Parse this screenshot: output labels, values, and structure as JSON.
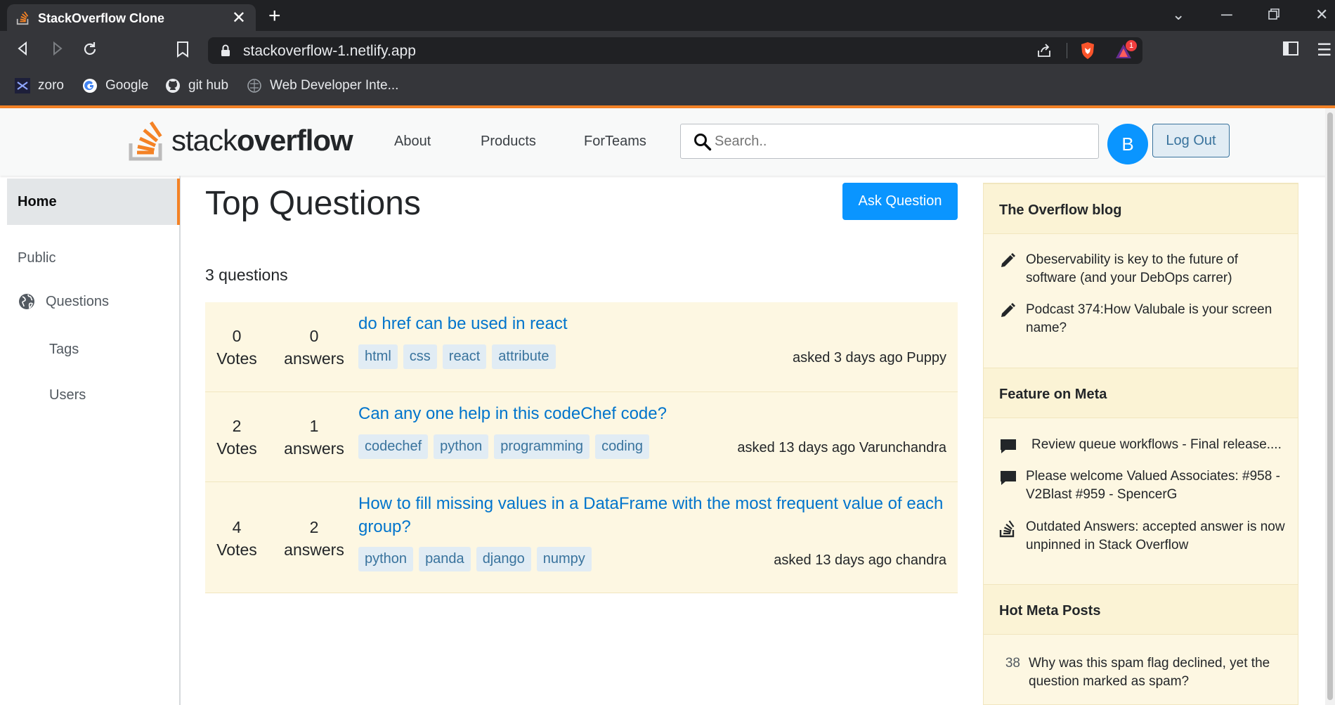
{
  "browser": {
    "tab_title": "StackOverflow Clone",
    "url": "stackoverflow-1.netlify.app",
    "bookmarks": [
      "zoro",
      "Google",
      "git hub",
      "Web Developer Inte..."
    ],
    "rewards_badge": "1"
  },
  "nav": {
    "logo_light": "stack",
    "logo_bold": "overflow",
    "links": [
      "About",
      "Products",
      "ForTeams"
    ],
    "search_placeholder": "Search..",
    "avatar_letter": "B",
    "logout_label": "Log Out"
  },
  "sidebar": {
    "home": "Home",
    "public": "Public",
    "questions": "Questions",
    "tags": "Tags",
    "users": "Users"
  },
  "main": {
    "title": "Top Questions",
    "ask_button": "Ask Question",
    "count_label": "3 questions",
    "questions": [
      {
        "votes": "0",
        "votes_label": "Votes",
        "answers": "0",
        "answers_label": "answers",
        "title": "do href can be used in react",
        "tags": [
          "html",
          "css",
          "react",
          "attribute"
        ],
        "asked": "asked 3 days ago Puppy"
      },
      {
        "votes": "2",
        "votes_label": "Votes",
        "answers": "1",
        "answers_label": "answers",
        "title": "Can any one help in this codeChef code?",
        "tags": [
          "codechef",
          "python",
          "programming",
          "coding"
        ],
        "asked": "asked 13 days ago Varunchandra"
      },
      {
        "votes": "4",
        "votes_label": "Votes",
        "answers": "2",
        "answers_label": "answers",
        "title": "How to fill missing values in a DataFrame with the most frequent value of each group?",
        "tags": [
          "python",
          "panda",
          "django",
          "numpy"
        ],
        "asked": "asked 13 days ago chandra"
      }
    ]
  },
  "right_sidebar": {
    "blog_heading": "The Overflow blog",
    "blog_items": [
      "Obeservability is key to the future of software (and your DebOps carrer)",
      "Podcast 374:How Valubale is your screen name?"
    ],
    "meta_heading": "Feature on Meta",
    "meta_items": [
      "Review queue workflows - Final release....",
      "Please welcome Valued Associates: #958 - V2Blast #959 - SpencerG",
      "Outdated Answers: accepted answer is now unpinned in Stack Overflow"
    ],
    "hot_heading": "Hot Meta Posts",
    "hot_items": [
      {
        "count": "38",
        "text": "Why was this spam flag declined, yet the question marked as spam?"
      }
    ]
  },
  "colors": {
    "accent_orange": "#f48225",
    "link_blue": "#0074cc",
    "button_blue": "#0a95ff",
    "panel_cream": "#fdf7e2"
  }
}
